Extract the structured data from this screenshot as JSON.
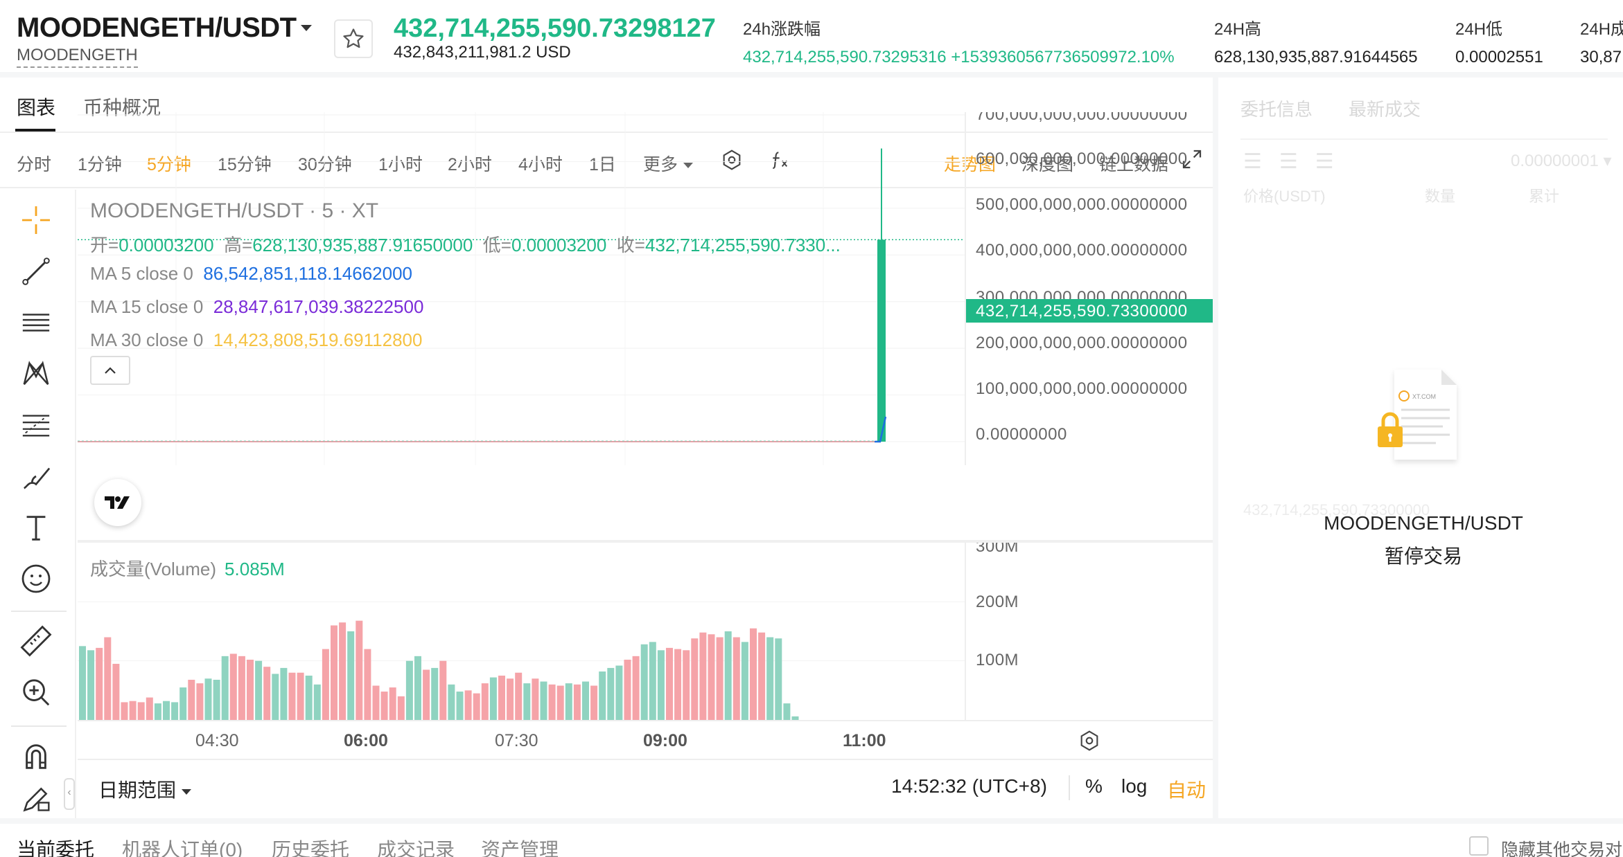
{
  "header": {
    "pair": "MOODENGETH/USDT",
    "pair_sub": "MOODENGETH",
    "last_price": "432,714,255,590.73298127",
    "last_price_usd": "432,843,211,981.2 USD",
    "change_label": "24h涨跌幅",
    "change_value": "432,714,255,590.73295316 +1539360567736509972.10%",
    "high_label": "24H高",
    "high_value": "628,130,935,887.91644565",
    "low_label": "24H低",
    "low_value": "0.00002551",
    "vol_label": "24H成",
    "vol_value": "30,87"
  },
  "chart_tabs": [
    "图表",
    "币种概况"
  ],
  "intervals": [
    "分时",
    "1分钟",
    "5分钟",
    "15分钟",
    "30分钟",
    "1小时",
    "2小时",
    "4小时",
    "1日",
    "更多"
  ],
  "active_interval": "5分钟",
  "view_modes": [
    "走势图",
    "深度图",
    "链上数据"
  ],
  "active_view": "走势图",
  "legend": {
    "title": "MOODENGETH/USDT · 5 · XT",
    "open_label": "开=",
    "open": "0.00003200",
    "high_label": "高=",
    "high": "628,130,935,887.91650000",
    "low_label": "低=",
    "low": "0.00003200",
    "close_label": "收=",
    "close": "432,714,255,590.7330...",
    "ma5_label": "MA 5 close 0",
    "ma5": "86,542,851,118.14662000",
    "ma15_label": "MA 15 close 0",
    "ma15": "28,847,617,039.38222500",
    "ma30_label": "MA 30 close 0",
    "ma30": "14,423,808,519.69112800"
  },
  "price_axis": {
    "ticks": [
      "700,000,000,000.00000000",
      "600,000,000,000.00000000",
      "500,000,000,000.00000000",
      "400,000,000,000.00000000",
      "300,000,000,000.00000000",
      "200,000,000,000.00000000",
      "100,000,000,000.00000000",
      "0.00000000"
    ],
    "current": "432,714,255,590.73300000"
  },
  "volume": {
    "label": "成交量(Volume)",
    "value": "5.085M",
    "ticks": [
      "300M",
      "200M",
      "100M"
    ]
  },
  "time_axis": [
    {
      "label": "04:30",
      "bold": false
    },
    {
      "label": "06:00",
      "bold": true
    },
    {
      "label": "07:30",
      "bold": false
    },
    {
      "label": "09:00",
      "bold": true
    },
    {
      "label": "11:00",
      "bold": true
    }
  ],
  "bottom_bar": {
    "date_range": "日期范围",
    "clock": "14:52:32 (UTC+8)",
    "percent": "%",
    "log": "log",
    "auto": "自动"
  },
  "right_panel": {
    "tabs": [
      "委托信息",
      "最新成交"
    ],
    "precision": "0.00000001",
    "col_price": "价格(USDT)",
    "col_amount": "数量",
    "col_total": "累计",
    "faint_row": "432,714,255,590.73300000",
    "paused_pair": "MOODENGETH/USDT",
    "paused_text": "暂停交易",
    "lock_brand": "XT.COM"
  },
  "footer": {
    "tabs": [
      "当前委托",
      "机器人订单(0)",
      "历史委托",
      "成交记录",
      "资产管理"
    ],
    "hide_others": "隐藏其他交易对"
  },
  "colors": {
    "up": "#20b887",
    "down": "#f5a3a8",
    "accent": "#f5a623"
  },
  "chart_data": {
    "type": "bar",
    "title": "MOODENGETH/USDT · 5 · XT",
    "y_range": [
      0,
      700000000000
    ],
    "candles": [
      {
        "x": "11:00",
        "open": 3.2e-05,
        "high": 628130935887.9165,
        "low": 3.2e-05,
        "close": 432714255590.733
      }
    ],
    "volume_series": {
      "name": "成交量(Volume)",
      "values": [
        125,
        118,
        122,
        140,
        95,
        30,
        32,
        30,
        38,
        28,
        32,
        30,
        55,
        68,
        62,
        70,
        68,
        108,
        112,
        108,
        102,
        100,
        90,
        78,
        88,
        80,
        80,
        75,
        60,
        120,
        160,
        165,
        150,
        168,
        120,
        58,
        48,
        55,
        40,
        100,
        108,
        85,
        88,
        100,
        60,
        48,
        50,
        45,
        62,
        72,
        75,
        70,
        80,
        62,
        70,
        65,
        60,
        58,
        62,
        60,
        65,
        58,
        82,
        88,
        92,
        102,
        108,
        128,
        132,
        118,
        122,
        120,
        118,
        138,
        148,
        145,
        140,
        150,
        140,
        132,
        155,
        148,
        140,
        138,
        28,
        6
      ],
      "colors": "ggrrrrrrrggggrrgggrrrgrggrrggrrrgrrrrrrggrgrggrrrgrrrgrgrrgrgrgggrrgggrrrrrrrgrgrrgg",
      "ylim": [
        0,
        300
      ]
    },
    "x_ticks": [
      "04:30",
      "06:00",
      "07:30",
      "09:00",
      "11:00"
    ]
  }
}
